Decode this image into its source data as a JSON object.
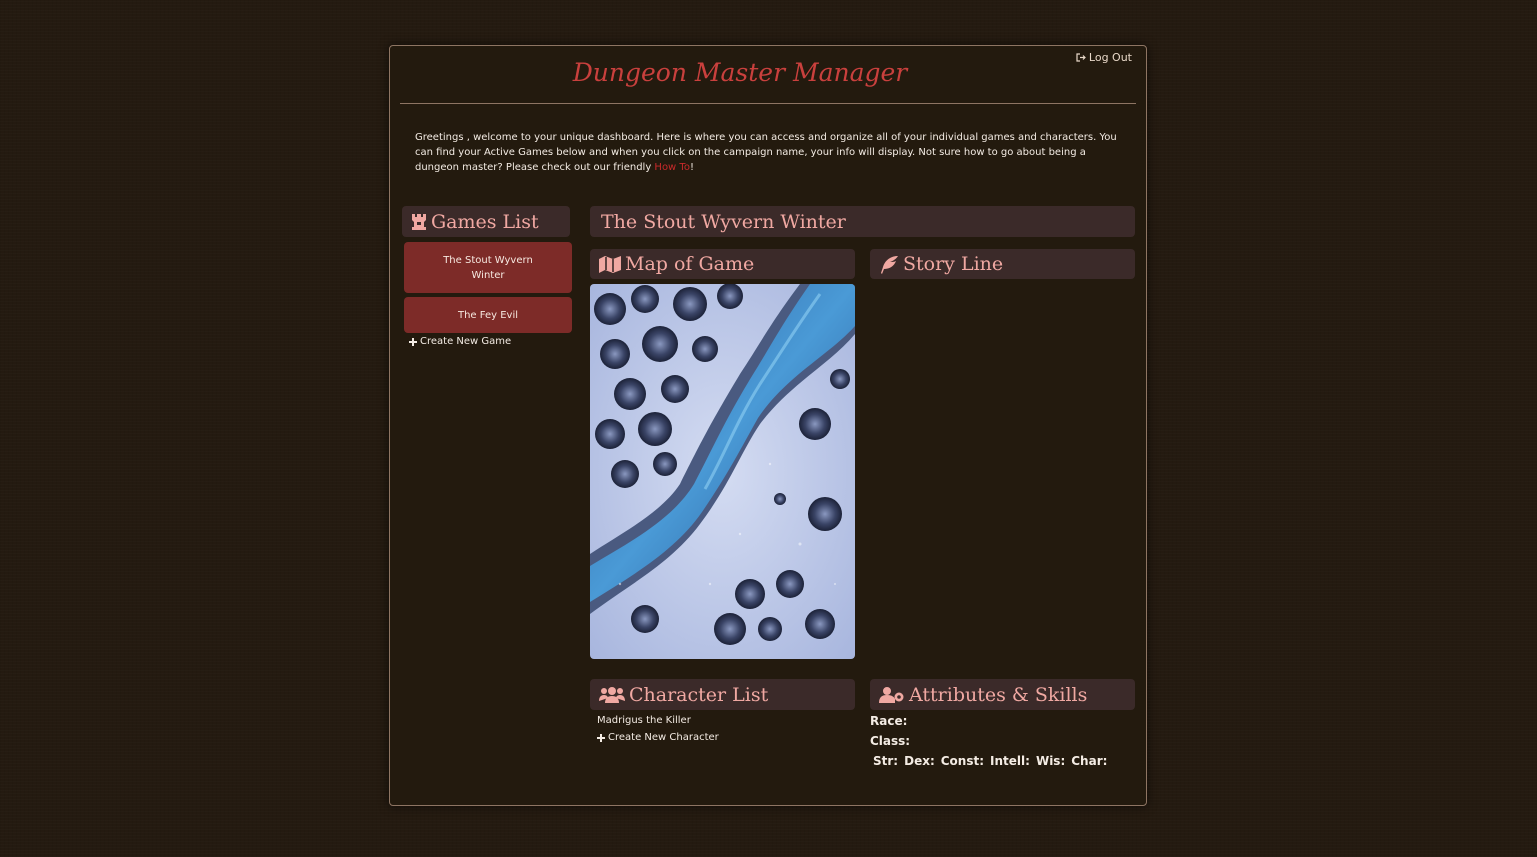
{
  "header": {
    "app_title": "Dungeon Master Manager",
    "logout_label": "Log Out"
  },
  "greeting": {
    "text_before": "Greetings , welcome to your unique dashboard. Here is where you can access and organize all of your individual games and characters. You can find your Active Games below and when you click on the campaign name, your info will display. Not sure how to go about being a dungeon master? Please check out our friendly ",
    "link_label": "How To",
    "text_after": "!"
  },
  "games_list": {
    "title": "Games List",
    "items": [
      {
        "label": "The Stout Wyvern Winter"
      },
      {
        "label": "The Fey Evil"
      }
    ],
    "create_label": "Create New Game"
  },
  "campaign": {
    "title": "The Stout Wyvern Winter"
  },
  "map": {
    "title": "Map of Game"
  },
  "story": {
    "title": "Story Line"
  },
  "characters": {
    "title": "Character List",
    "items": [
      {
        "name": "Madrigus the Killer"
      }
    ],
    "create_label": "Create New Character"
  },
  "attributes": {
    "title": "Attributes & Skills",
    "race_label": "Race:",
    "class_label": "Class:",
    "stats": [
      "Str:",
      "Dex:",
      "Const:",
      "Intell:",
      "Wis:",
      "Char:"
    ]
  },
  "colors": {
    "accent_red": "#c9403d",
    "button_red": "#7d2b28",
    "header_bg": "#3b2a29",
    "header_text": "#f0a8a2"
  }
}
